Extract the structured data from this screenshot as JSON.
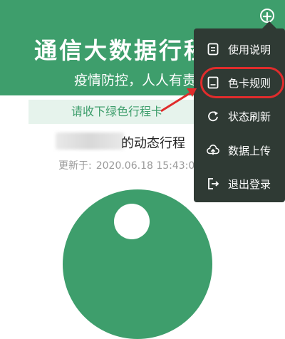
{
  "header": {
    "title": "通信大数据行程",
    "subtitle": "疫情防控，人人有责"
  },
  "banner": {
    "text": "请收下绿色行程卡"
  },
  "card": {
    "title_suffix": "的动态行程",
    "updated_label": "更新于:",
    "updated_time": "2020.06.18 15:43:0"
  },
  "menu": {
    "items": [
      {
        "label": "使用说明",
        "icon": "document-icon"
      },
      {
        "label": "色卡规则",
        "icon": "card-rule-icon"
      },
      {
        "label": "状态刷新",
        "icon": "refresh-icon"
      },
      {
        "label": "数据上传",
        "icon": "cloud-upload-icon"
      },
      {
        "label": "退出登录",
        "icon": "logout-icon"
      }
    ]
  },
  "colors": {
    "brand_green": "#3e9e6c",
    "menu_bg": "#2f3a34",
    "highlight_red": "#e02c2c"
  }
}
